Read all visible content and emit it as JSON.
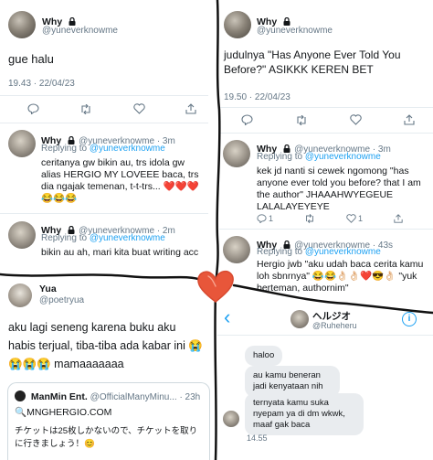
{
  "panel_a": {
    "name": "Why",
    "handle": "@yuneverknowme",
    "text": "gue halu",
    "timestamp": "19.43 · 22/04/23",
    "reply1": {
      "name": "Why",
      "handle": "@yuneverknowme · 3m",
      "replying_to": "Replying to",
      "replying_handle": "@yuneverknowme",
      "text": "ceritanya gw bikin au, trs idola gw alias HERGIO MY LOVEEE baca, trs dia ngajak temenan, t-t-trs... ❤️❤️❤️😂😂😂"
    },
    "reply2": {
      "name": "Why",
      "handle": "@yuneverknowme · 2m",
      "replying_to": "Replying to",
      "replying_handle": "@yuneverknowme",
      "text": "bikin au ah, mari kita buat writing acc"
    }
  },
  "panel_b": {
    "name": "Why",
    "handle": "@yuneverknowme",
    "text": "judulnya \"Has Anyone Ever Told You Before?\" ASIKKK KEREN BET",
    "timestamp": "19.50 · 22/04/23",
    "reply1": {
      "name": "Why",
      "handle": "@yuneverknowme · 3m",
      "replying_to": "Replying to",
      "replying_handle": "@yuneverknowme",
      "text": "kek jd nanti si cewek ngomong \"has anyone ever told you before? that I am the author\" JHAAAHWYEGEUE LALALAYEYEYE",
      "reply_count": "1",
      "like_count": "1"
    },
    "reply2": {
      "name": "Why",
      "handle": "@yuneverknowme · 43s",
      "replying_to": "Replying to",
      "replying_handle": "@yuneverknowme",
      "text": "Hergio jwb \"aku udah baca cerita kamu loh sbnrnya\" 😂😂👌🏻👌🏻❤️😎👌🏻 \"yuk berteman, authornim\""
    }
  },
  "panel_c": {
    "name": "Yua",
    "handle": "@poetryua",
    "text": "aku lagi seneng karena buku aku habis terjual, tiba-tiba ada kabar ini 😭😭😭😭 mamaaaaaaa",
    "quote": {
      "name": "ManMin Ent.",
      "handle": "@OfficialManyMinu... · 23h",
      "title": "MNGHERGIO.COM",
      "title_prefix": "🔍",
      "text": "チケットは25枚しかないので、チケットを取りに行きましょう！😊"
    }
  },
  "panel_d": {
    "back": "‹",
    "name": "ヘルジオ",
    "handle": "@Ruheheru",
    "info": "i",
    "messages": [
      "haloo",
      "au kamu beneran jadi kenyataan nih",
      "ternyata kamu suka nyepam ya di dm wkwk, maaf gak baca"
    ],
    "time": "14.55"
  },
  "colors": {
    "link": "#1da1f2",
    "muted": "#657786",
    "heart": "#e8563a",
    "divider": "#111111"
  },
  "icons": [
    "lock-icon",
    "reply-icon",
    "retweet-icon",
    "like-icon",
    "share-icon",
    "heart-doodle-icon",
    "back-chevron-icon",
    "info-icon"
  ]
}
